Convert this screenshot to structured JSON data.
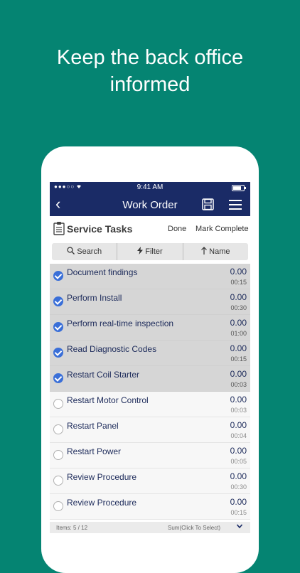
{
  "headline": {
    "line1": "Keep the back office",
    "line2": "informed"
  },
  "status": {
    "carrier": "●●●○○",
    "time": "9:41 AM"
  },
  "nav": {
    "back": "‹",
    "title": "Work Order"
  },
  "section": {
    "title": "Service Tasks",
    "done_label": "Done",
    "mark_complete_label": "Mark Complete"
  },
  "toolbar": {
    "search": "Search",
    "filter": "Filter",
    "name": "Name"
  },
  "tasks": [
    {
      "name": "Document findings",
      "value": "0.00",
      "duration": "00:15",
      "done": true
    },
    {
      "name": "Perform Install",
      "value": "0.00",
      "duration": "00:30",
      "done": true
    },
    {
      "name": "Perform real-time inspection",
      "value": "0.00",
      "duration": "01:00",
      "done": true
    },
    {
      "name": "Read Diagnostic Codes",
      "value": "0.00",
      "duration": "00:15",
      "done": true
    },
    {
      "name": "Restart Coil Starter",
      "value": "0.00",
      "duration": "00:03",
      "done": true
    },
    {
      "name": "Restart Motor Control",
      "value": "0.00",
      "duration": "00:03",
      "done": false
    },
    {
      "name": "Restart Panel",
      "value": "0.00",
      "duration": "00:04",
      "done": false
    },
    {
      "name": "Restart Power",
      "value": "0.00",
      "duration": "00:05",
      "done": false
    },
    {
      "name": "Review Procedure",
      "value": "0.00",
      "duration": "00:30",
      "done": false
    },
    {
      "name": "Review Procedure",
      "value": "0.00",
      "duration": "00:15",
      "done": false
    }
  ],
  "footer": {
    "items": "Items: 5 / 12",
    "sum": "Sum(Click To Select)"
  },
  "colors": {
    "background": "#058472",
    "navbar": "#1a2b66",
    "check": "#3a6fd8"
  }
}
